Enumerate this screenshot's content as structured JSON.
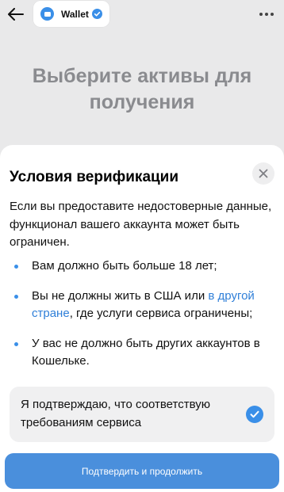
{
  "header": {
    "app_name": "Wallet",
    "back_icon": "arrow-left-icon",
    "more_icon": "ellipsis-icon",
    "verified_icon": "verified-badge-icon"
  },
  "background": {
    "heading": "Выберите активы для получения"
  },
  "sheet": {
    "title": "Условия верификации",
    "intro": "Если вы предоставите недостоверные данные, функционал вашего аккаунта может быть ограничен.",
    "bullets": {
      "b1": "Вам должно быть больше 18 лет;",
      "b2_before": "Вы не должны жить в США или ",
      "b2_link": "в другой стране",
      "b2_after": ", где услуги сервиса ограничены;",
      "b3": "У вас не должно быть других аккаунтов в Кошельке."
    },
    "confirm_text": "Я подтверждаю, что соответствую требованиям сервиса",
    "confirm_checked": true,
    "primary_button": "Подтвердить и продолжить"
  },
  "colors": {
    "accent": "#3a8fe8",
    "primary_button": "#4a8fdc",
    "link": "#2f7fd8",
    "muted_heading": "#8a8b8f"
  }
}
